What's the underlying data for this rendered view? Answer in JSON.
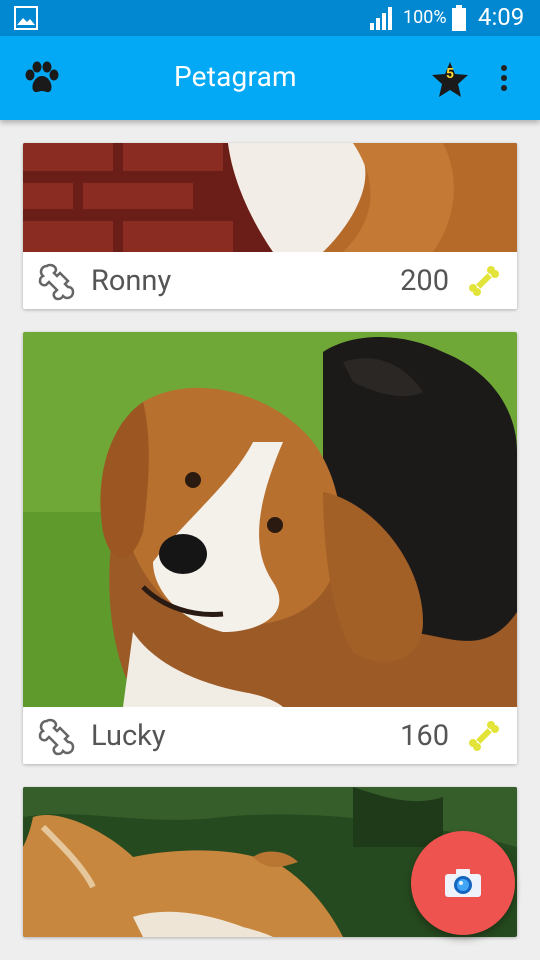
{
  "status_bar": {
    "battery_percent": "100%",
    "time": "4:09",
    "icons": [
      "gallery-icon",
      "signal-icon",
      "battery-icon"
    ]
  },
  "app_bar": {
    "title": "Petagram",
    "favorites_badge": "5",
    "icons": [
      "paw-icon",
      "star-icon",
      "overflow-menu-icon"
    ]
  },
  "pets": [
    {
      "name": "Ronny",
      "likes": "200"
    },
    {
      "name": "Lucky",
      "likes": "160"
    },
    {
      "name": "",
      "likes": ""
    }
  ],
  "colors": {
    "status_bar": "#0288d1",
    "app_bar": "#03a9f4",
    "fab": "#ef5350",
    "rating_bone": "#e2e43a",
    "background": "#eeeeee"
  },
  "fab": {
    "icon": "camera-icon"
  }
}
